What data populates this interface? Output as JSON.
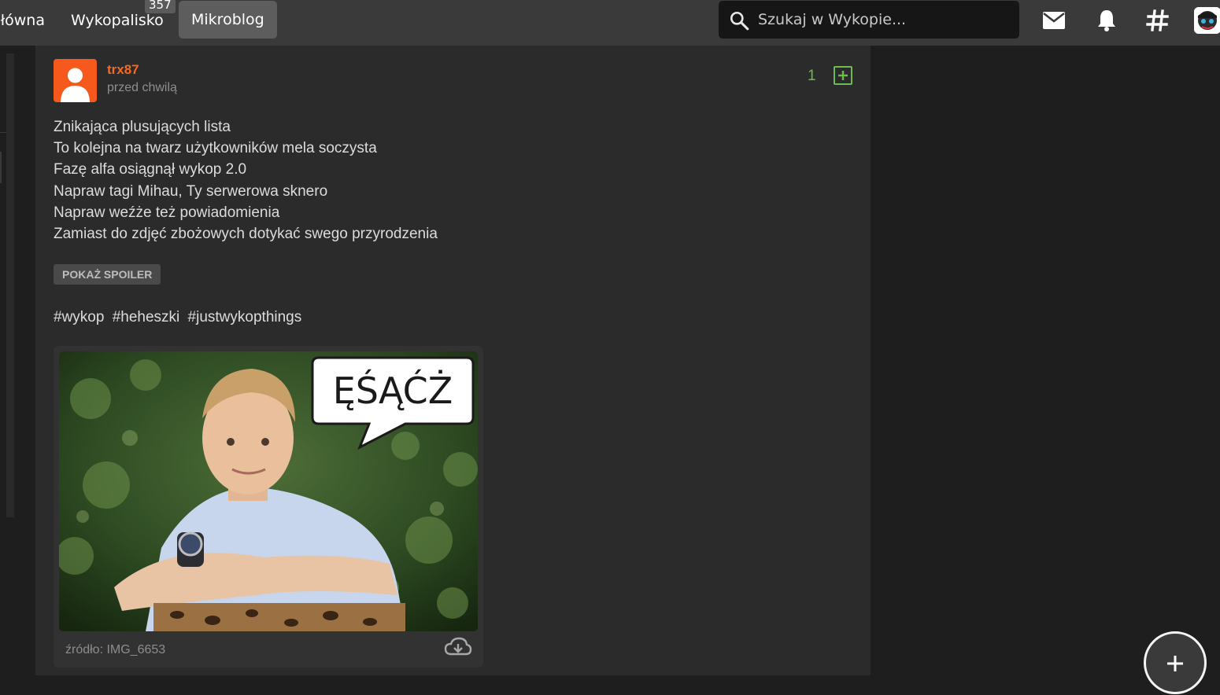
{
  "nav": {
    "home_label": "Główna",
    "wykopalisko_label": "Wykopalisko",
    "wykopalisko_badge": "357",
    "mikroblog_label": "Mikroblog"
  },
  "search": {
    "placeholder": "Szukaj w Wykopie..."
  },
  "icons": {
    "search": "search-icon",
    "mail": "mail-icon",
    "notifications": "bell-icon",
    "tags": "hash-icon",
    "download": "cloud-download-icon",
    "add": "plus-icon"
  },
  "colors": {
    "accent": "#f56a20",
    "vote": "#6dbb4e",
    "topbar": "#3a3a3b",
    "background": "#1e1e1f",
    "post_background": "#2b2b2c"
  },
  "post": {
    "username": "trx87",
    "timestamp": "przed chwilą",
    "vote_count": "1",
    "lines": [
      "Znikająca plusujących lista",
      "To kolejna na twarz użytkowników mela soczysta",
      "Fazę alfa osiągnął wykop 2.0",
      "Napraw tagi Mihau, Ty serwerowa sknero",
      "Napraw weźże też powiadomienia",
      "Zamiast do zdjęć zbożowych dotykać swego przyrodzenia"
    ],
    "spoiler_label": "POKAŻ SPOILER",
    "tags": [
      "#wykop",
      "#heheszki",
      "#justwykopthings"
    ],
    "image_caption": "ĘŚĄĆŻ",
    "source_label": "źródło: IMG_6653"
  }
}
